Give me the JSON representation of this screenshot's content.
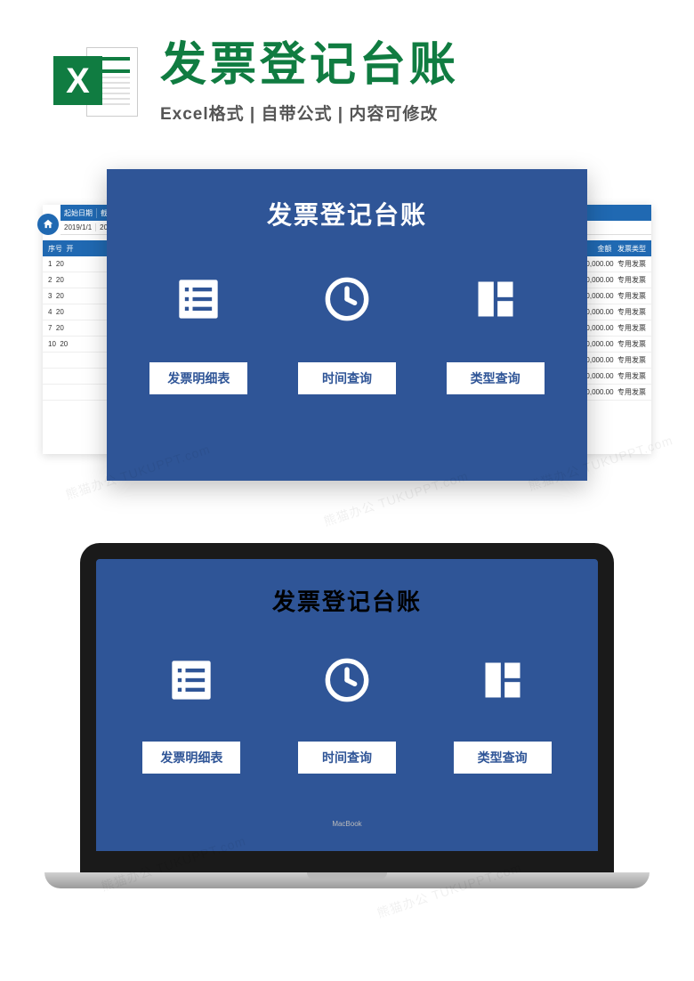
{
  "header": {
    "logo_letter": "X",
    "title": "发票登记台账",
    "subtitle": "Excel格式 | 自带公式 | 内容可修改"
  },
  "panel": {
    "title": "发票登记台账",
    "buttons": {
      "detail": "发票明细表",
      "time": "时间查询",
      "type": "类型查询"
    }
  },
  "spreadsheet": {
    "date_header1": "起始日期",
    "date_header2": "截",
    "date1": "2019/1/1",
    "date2": "20",
    "col_seq": "序号",
    "col_open": "开",
    "col_amount": "金额",
    "col_type": "发票类型",
    "rows": [
      {
        "seq": "1",
        "open": "20",
        "amount": "0,000.00",
        "type": "专用发票"
      },
      {
        "seq": "2",
        "open": "20",
        "amount": "0,000.00",
        "type": "专用发票"
      },
      {
        "seq": "3",
        "open": "20",
        "amount": "0,000.00",
        "type": "专用发票"
      },
      {
        "seq": "4",
        "open": "20",
        "amount": "0,000.00",
        "type": "专用发票"
      },
      {
        "seq": "7",
        "open": "20",
        "amount": "0,000.00",
        "type": "专用发票"
      },
      {
        "seq": "10",
        "open": "20",
        "amount": "0,000.00",
        "type": "专用发票"
      },
      {
        "seq": "",
        "open": "",
        "amount": "0,000.00",
        "type": "专用发票"
      },
      {
        "seq": "",
        "open": "",
        "amount": "0,000.00",
        "type": "专用发票"
      },
      {
        "seq": "",
        "open": "",
        "amount": "0,000.00",
        "type": "专用发票"
      }
    ]
  },
  "laptop_label": "MacBook",
  "watermark": "熊猫办公 TUKUPPT.com"
}
